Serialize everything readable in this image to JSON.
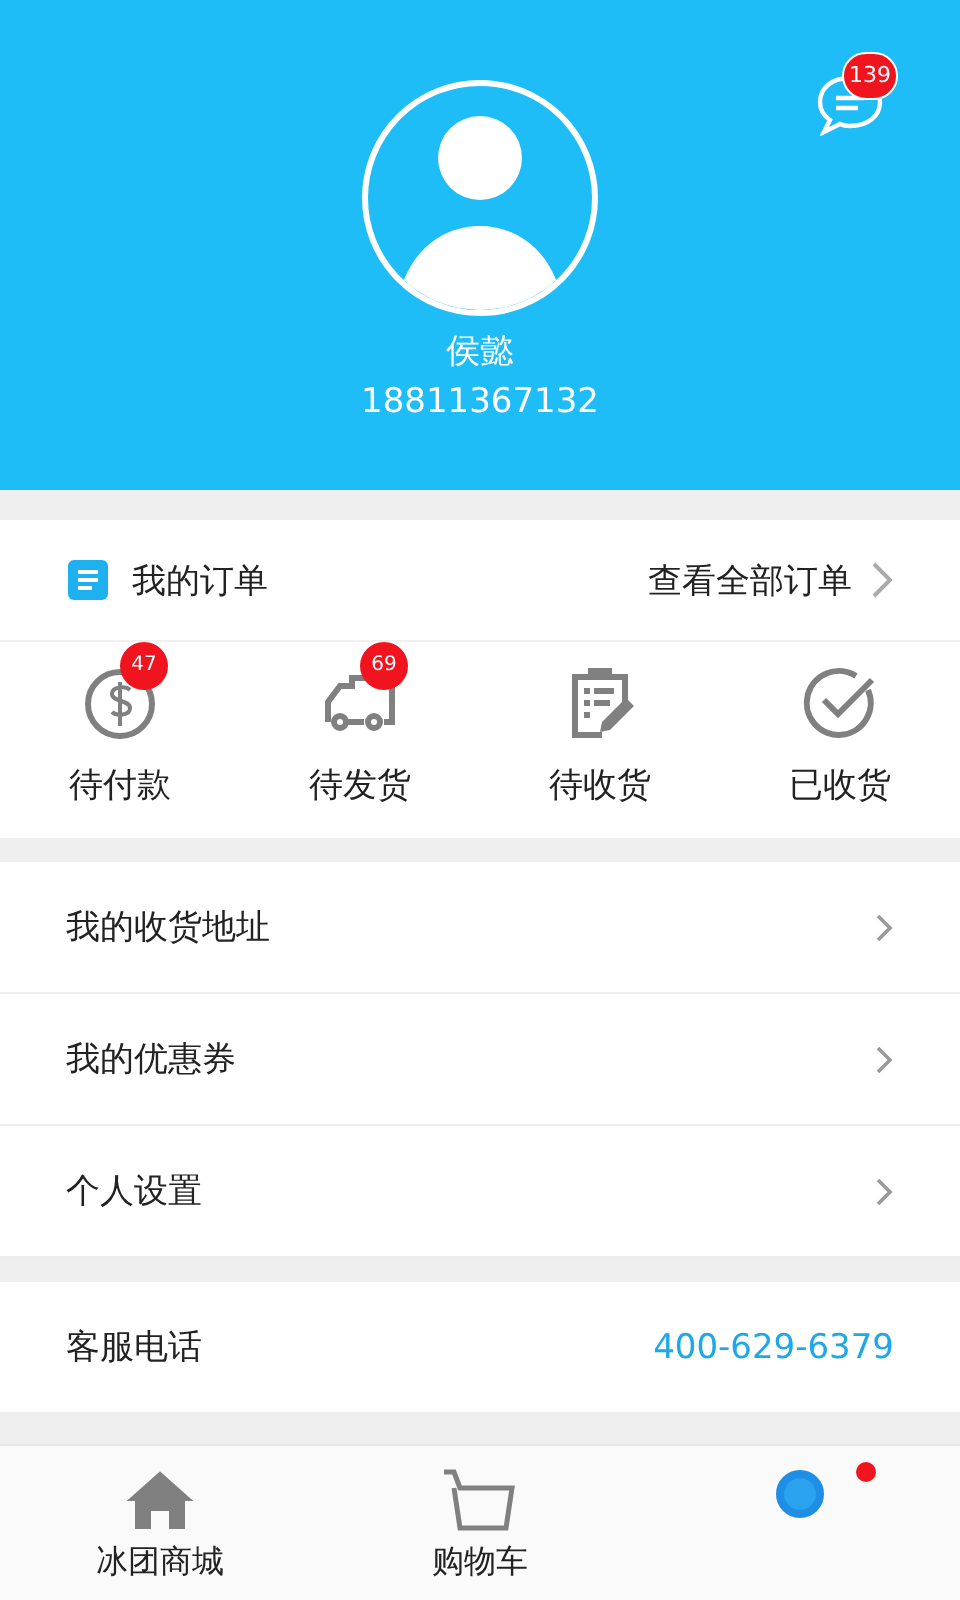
{
  "header": {
    "message_badge": "139",
    "name": "侯懿",
    "phone": "18811367132"
  },
  "orders": {
    "title": "我的订单",
    "view_all": "查看全部订单",
    "items": [
      {
        "kind": "payment",
        "label": "待付款",
        "badge": "47"
      },
      {
        "kind": "shipping",
        "label": "待发货",
        "badge": "69"
      },
      {
        "kind": "receiving",
        "label": "待收货"
      },
      {
        "kind": "received",
        "label": "已收货"
      }
    ]
  },
  "menu": [
    {
      "label": "我的收货地址"
    },
    {
      "label": "我的优惠券"
    },
    {
      "label": "个人设置"
    }
  ],
  "service": {
    "label": "客服电话",
    "phone": "400-629-6379"
  },
  "tabs": [
    {
      "kind": "home",
      "label": "冰团商城",
      "selected": false,
      "dot": false
    },
    {
      "kind": "cart",
      "label": "购物车",
      "selected": false,
      "dot": false
    },
    {
      "kind": "profile",
      "selected": true,
      "dot": true
    }
  ]
}
